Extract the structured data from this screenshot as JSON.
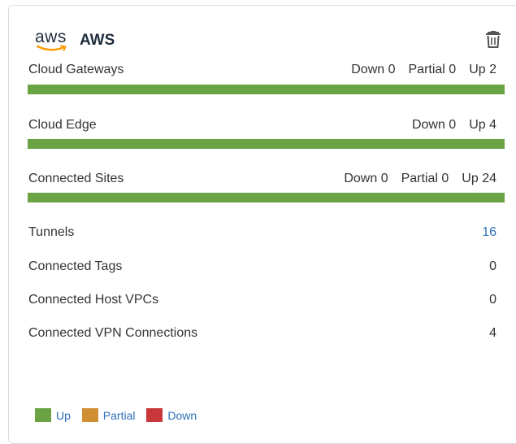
{
  "provider": {
    "logo_text": "aws",
    "title": "AWS"
  },
  "sections": [
    {
      "label": "Cloud Gateways",
      "statuses": [
        "Down 0",
        "Partial 0",
        "Up 2"
      ],
      "up_fraction": 1.0
    },
    {
      "label": "Cloud Edge",
      "statuses": [
        "Down 0",
        "Up 4"
      ],
      "up_fraction": 1.0
    },
    {
      "label": "Connected Sites",
      "statuses": [
        "Down 0",
        "Partial 0",
        "Up 24"
      ],
      "up_fraction": 1.0
    }
  ],
  "metrics": [
    {
      "label": "Tunnels",
      "value": "16"
    },
    {
      "label": "Connected Tags",
      "value": "0"
    },
    {
      "label": "Connected Host VPCs",
      "value": "0"
    },
    {
      "label": "Connected VPN Connections",
      "value": "4"
    }
  ],
  "legend": [
    {
      "label": "Up",
      "color": "#6aa343"
    },
    {
      "label": "Partial",
      "color": "#d08f33"
    },
    {
      "label": "Down",
      "color": "#c9373b"
    }
  ],
  "icons": {
    "delete": "trash-icon",
    "logo": "aws-logo-icon"
  }
}
